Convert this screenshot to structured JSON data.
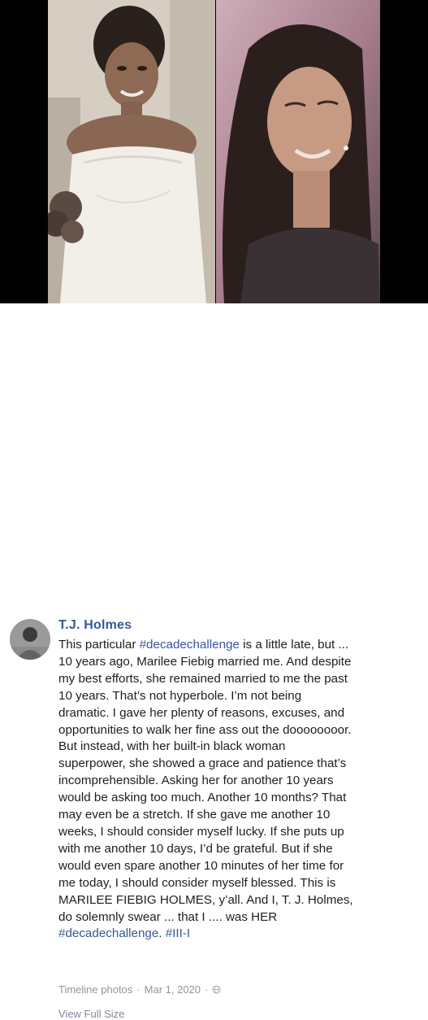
{
  "post": {
    "author": "T.J. Holmes",
    "text_lines": [
      [
        {
          "t": "This particular "
        },
        {
          "t": "#decadechallenge",
          "tag": true
        },
        {
          "t": " is a little late, but ..."
        }
      ],
      [
        {
          "t": "10 years ago, Marilee Fiebig married me. And despite"
        }
      ],
      [
        {
          "t": "my best efforts, she remained married to me the past"
        }
      ],
      [
        {
          "t": "10 years. That’s not hyperbole. I’m not being"
        }
      ],
      [
        {
          "t": "dramatic. I gave her plenty of reasons, excuses, and"
        }
      ],
      [
        {
          "t": "opportunities to walk her fine ass out the doooooooor."
        }
      ],
      [
        {
          "t": "But instead, with her built-in black woman"
        }
      ],
      [
        {
          "t": "superpower, she showed a grace and patience that’s"
        }
      ],
      [
        {
          "t": "incomprehensible. Asking her for another 10 years"
        }
      ],
      [
        {
          "t": "would be asking too much. Another 10 months? That"
        }
      ],
      [
        {
          "t": "may even be a stretch. If she gave me another 10"
        }
      ],
      [
        {
          "t": "weeks, I should consider myself lucky. If she puts up"
        }
      ],
      [
        {
          "t": "with me another 10 days, I’d be grateful. But if she"
        }
      ],
      [
        {
          "t": "would even spare another 10 minutes of her time for"
        }
      ],
      [
        {
          "t": "me today, I should consider myself blessed. This is"
        }
      ],
      [
        {
          "t": "MARILEE FIEBIG HOLMES, y’all. And I, T. J. Holmes,"
        }
      ],
      [
        {
          "t": "do solemnly swear ... that I .... was HER"
        }
      ],
      [
        {
          "t": "#decadechallenge",
          "tag": true
        },
        {
          "t": ". "
        },
        {
          "t": "#III-I",
          "tag": true
        }
      ]
    ],
    "meta": {
      "album": "Timeline photos",
      "separator": "·",
      "date": "Mar 1, 2020",
      "privacy_icon": "globe-icon"
    },
    "view_full_size": "View Full Size"
  },
  "colors": {
    "link": "#385898",
    "text": "#1c1e21",
    "meta": "#90949c",
    "background": "#ffffff",
    "photo_bg": "#000000"
  }
}
